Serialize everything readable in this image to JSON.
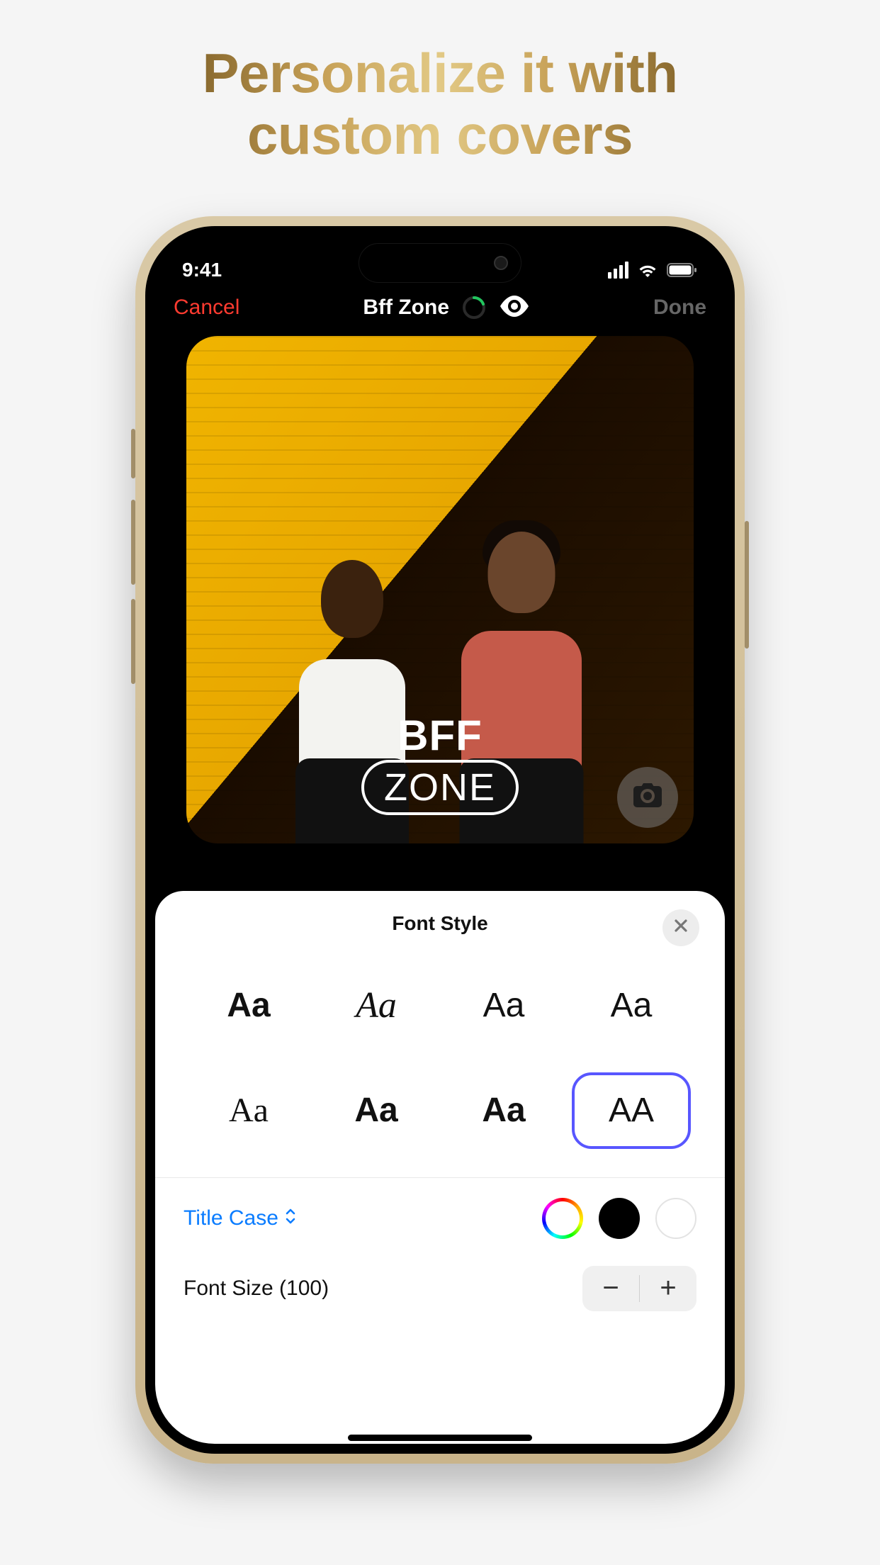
{
  "promo": {
    "headline_l1": "Personalize it with",
    "headline_l2": "custom covers"
  },
  "statusbar": {
    "time": "9:41"
  },
  "header": {
    "cancel": "Cancel",
    "title": "Bff Zone",
    "done": "Done"
  },
  "cover": {
    "word1": "BFF",
    "word2": "ZONE"
  },
  "sheet": {
    "title": "Font Style",
    "fonts": [
      {
        "label": "Aa"
      },
      {
        "label": "Aa"
      },
      {
        "label": "Aa"
      },
      {
        "label": "Aa"
      },
      {
        "label": "Aa"
      },
      {
        "label": "Aa"
      },
      {
        "label": "Aa"
      },
      {
        "label": "AA"
      }
    ],
    "selected_font_index": 7,
    "case_label": "Title Case",
    "colors": {
      "black": "#000000",
      "white": "#ffffff"
    },
    "size_label": "Font Size (100)",
    "size_value": 100
  }
}
